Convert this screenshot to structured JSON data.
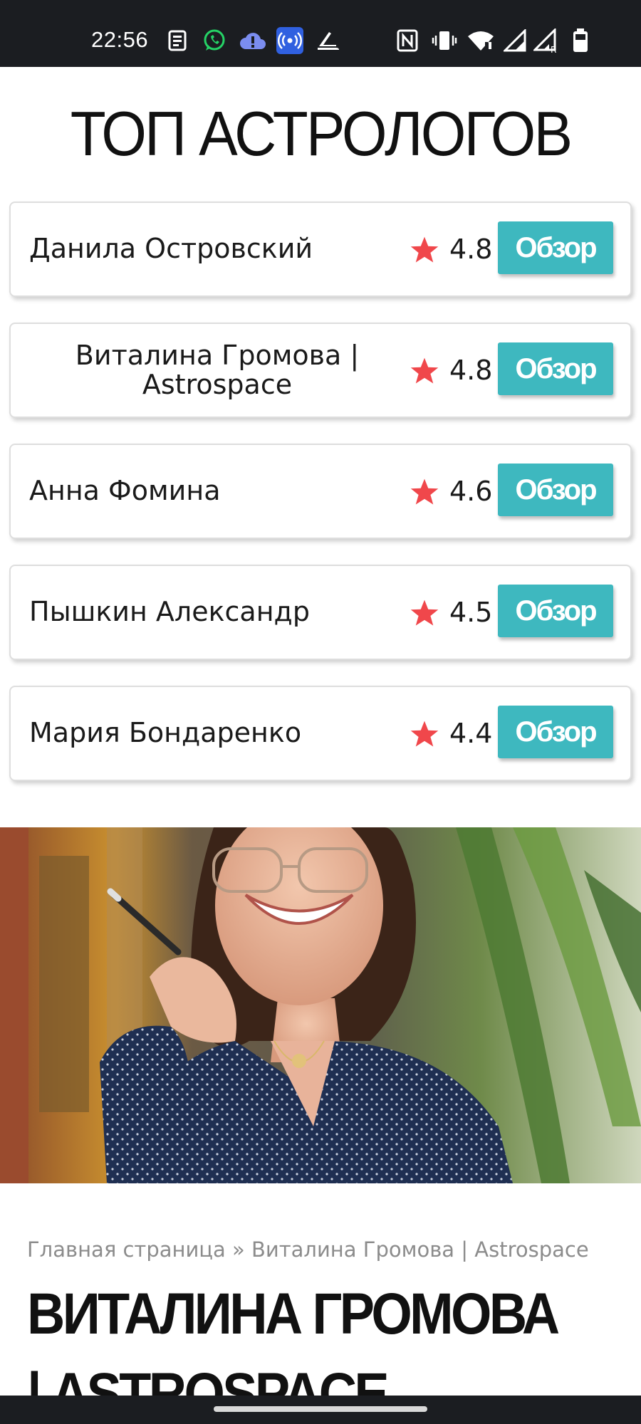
{
  "status_bar": {
    "time": "22:56",
    "left_icons": [
      "news-icon",
      "whatsapp-icon",
      "cloud-alert-icon",
      "nfc-broadcast-icon",
      "sneaker-icon"
    ],
    "right_icons": [
      "nfc-icon",
      "vibrate-icon",
      "wifi-icon",
      "signal-icon",
      "signal-roaming-icon",
      "battery-icon"
    ]
  },
  "page": {
    "title": "ТОП АСТРОЛОГОВ"
  },
  "astrologers": [
    {
      "name": "Данила Островский",
      "rating": "4.8",
      "button": "Обзор"
    },
    {
      "name": "Виталина Громова | Astrospace",
      "rating": "4.8",
      "button": "Обзор"
    },
    {
      "name": "Анна Фомина",
      "rating": "4.6",
      "button": "Обзор"
    },
    {
      "name": "Пышкин Александр",
      "rating": "4.5",
      "button": "Обзор"
    },
    {
      "name": "Мария Бондаренко",
      "rating": "4.4",
      "button": "Обзор"
    }
  ],
  "colors": {
    "star": "#f0474b",
    "button": "#3eb8bf",
    "status_bar": "#1b1d21"
  },
  "breadcrumb": {
    "home": "Главная страница",
    "separator": "»",
    "current": "Виталина Громова | Astrospace"
  },
  "article": {
    "title": "ВИТАЛИНА ГРОМОВА | ASTROSPACE"
  }
}
